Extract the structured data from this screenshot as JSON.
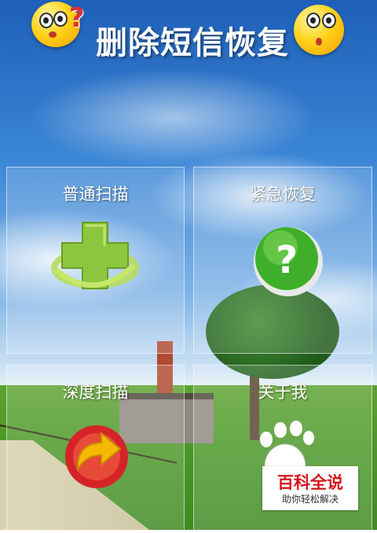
{
  "header": {
    "title": "删除短信恢复",
    "left_icon": "confused-smiley-icon",
    "right_icon": "surprised-smiley-icon"
  },
  "tiles": [
    {
      "label": "普通扫描",
      "icon": "green-cross-icon"
    },
    {
      "label": "紧急恢复",
      "icon": "question-mark-icon"
    },
    {
      "label": "深度扫描",
      "icon": "refresh-arrow-icon"
    },
    {
      "label": "关于我",
      "icon": "footprint-icon"
    }
  ],
  "watermark": {
    "title": "百科全说",
    "subtitle": "助你轻松解决"
  },
  "colors": {
    "cross": "#8cc63f",
    "question": "#3fae2a",
    "refresh_ring": "#d6232a",
    "refresh_arrow": "#f6b800",
    "watermark_red": "#d4161c"
  }
}
